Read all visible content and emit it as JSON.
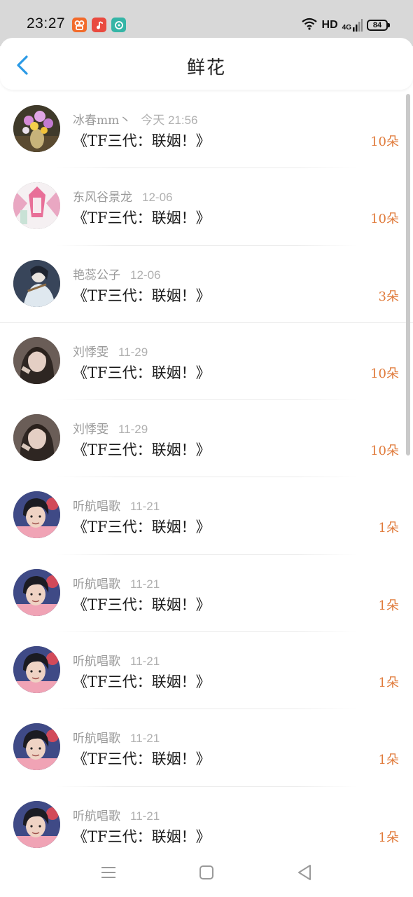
{
  "status_bar": {
    "time": "23:27",
    "hd": "HD",
    "network": "4G",
    "battery": "84",
    "apps": [
      "kuaishou-icon",
      "music-icon",
      "chat-icon"
    ]
  },
  "header": {
    "title": "鲜花",
    "back_icon": "chevron-left-icon"
  },
  "colors": {
    "accent_blue": "#2b9ae6",
    "count_orange": "#e07a3a",
    "status_bar_bg": "#d8d8d8"
  },
  "items": [
    {
      "user": "冰春mm丶",
      "time": "今天 21:56",
      "book": "《TF三代：联姻！》",
      "count": "10朵"
    },
    {
      "user": "东风谷景龙",
      "time": "12-06",
      "book": "《TF三代：联姻！》",
      "count": "10朵"
    },
    {
      "user": "艳蕊公子",
      "time": "12-06",
      "book": "《TF三代：联姻！》",
      "count": "3朵"
    },
    {
      "user": "刘悸雯",
      "time": "11-29",
      "book": "《TF三代：联姻！》",
      "count": "10朵"
    },
    {
      "user": "刘悸雯",
      "time": "11-29",
      "book": "《TF三代：联姻！》",
      "count": "10朵"
    },
    {
      "user": "听航唱歌",
      "time": "11-21",
      "book": "《TF三代：联姻！》",
      "count": "1朵"
    },
    {
      "user": "听航唱歌",
      "time": "11-21",
      "book": "《TF三代：联姻！》",
      "count": "1朵"
    },
    {
      "user": "听航唱歌",
      "time": "11-21",
      "book": "《TF三代：联姻！》",
      "count": "1朵"
    },
    {
      "user": "听航唱歌",
      "time": "11-21",
      "book": "《TF三代：联姻！》",
      "count": "1朵"
    },
    {
      "user": "听航唱歌",
      "time": "11-21",
      "book": "《TF三代：联姻！》",
      "count": "1朵"
    }
  ],
  "nav_bar": {
    "menu_icon": "menu-icon",
    "home_icon": "home-square-icon",
    "back_icon": "back-triangle-icon"
  }
}
